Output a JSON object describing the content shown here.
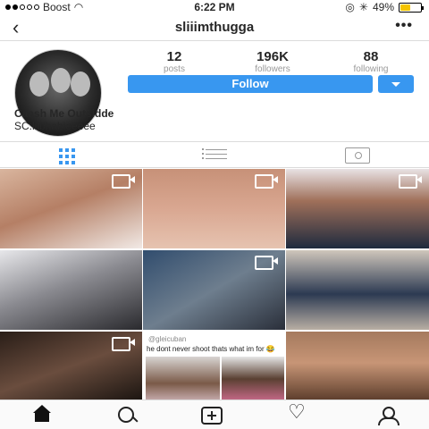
{
  "status_bar": {
    "carrier": "Boost",
    "time": "6:22 PM",
    "battery": "49%",
    "battery_level": 0.49
  },
  "nav": {
    "back_icon": "chevron-left-icon",
    "username": "sliiimthugga",
    "more_icon": "ellipsis-icon",
    "more_label": "•••"
  },
  "profile": {
    "stats": [
      {
        "value": "12",
        "label": "posts"
      },
      {
        "value": "196K",
        "label": "followers"
      },
      {
        "value": "88",
        "label": "following"
      }
    ],
    "follow_label": "Follow",
    "name": "Caash Me Outsidde",
    "bio": "SC:lilbhabieeeee"
  },
  "tabs": {
    "grid_icon": "grid-icon",
    "list_icon": "list-icon",
    "tagged_icon": "tagged-icon"
  },
  "grid": {
    "tiles": [
      {
        "video": true
      },
      {
        "video": true
      },
      {
        "video": true
      },
      {
        "video": false
      },
      {
        "video": true
      },
      {
        "video": false
      },
      {
        "video": true
      },
      {
        "video": false,
        "tweet_handle": "@gleicuban",
        "tweet_text": "he dont never shoot thats what im for 😂"
      },
      {
        "video": false
      }
    ]
  },
  "bottom_nav": [
    "home-icon",
    "search-icon",
    "add-post-icon",
    "heart-icon",
    "profile-icon"
  ],
  "colors": {
    "accent": "#3897f0",
    "battery": "#f5c400"
  }
}
